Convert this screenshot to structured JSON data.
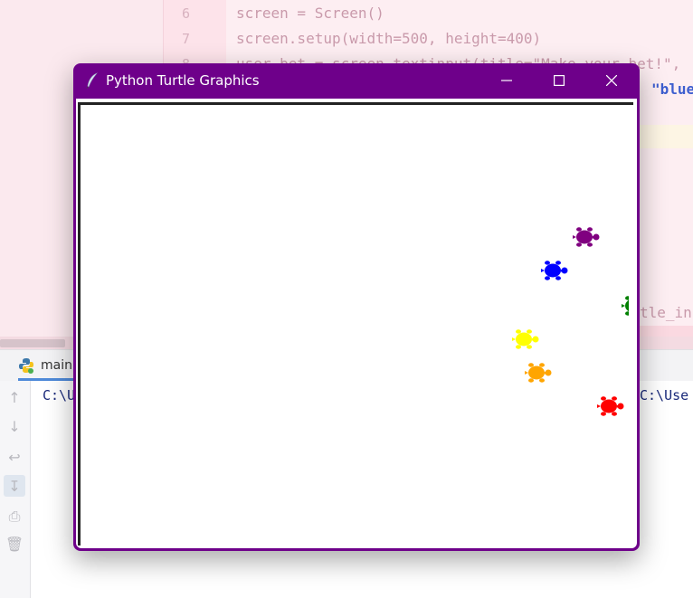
{
  "ide": {
    "code_lines": [
      {
        "num": "6",
        "text": "screen = Screen()"
      },
      {
        "num": "7",
        "text": "screen.setup(width=500, height=400)"
      },
      {
        "num": "8",
        "text": "user_bet = screen.textinput(title=\"Make your bet!\","
      }
    ],
    "right_fragments": {
      "blue": "\"blue",
      "title_in": "tle_in"
    },
    "run_tab": {
      "label": "main"
    },
    "console_left": "C:\\U",
    "console_right": "C:\\Use"
  },
  "turtle_window": {
    "title": "Python Turtle Graphics",
    "turtles": [
      {
        "color": "#800080",
        "name": "purple"
      },
      {
        "color": "#0000ff",
        "name": "blue"
      },
      {
        "color": "#008000",
        "name": "green"
      },
      {
        "color": "#ffff00",
        "name": "yellow"
      },
      {
        "color": "#ffa500",
        "name": "orange"
      },
      {
        "color": "#ff0000",
        "name": "red"
      }
    ]
  },
  "colors": {
    "window_frame": "#6e008a"
  }
}
